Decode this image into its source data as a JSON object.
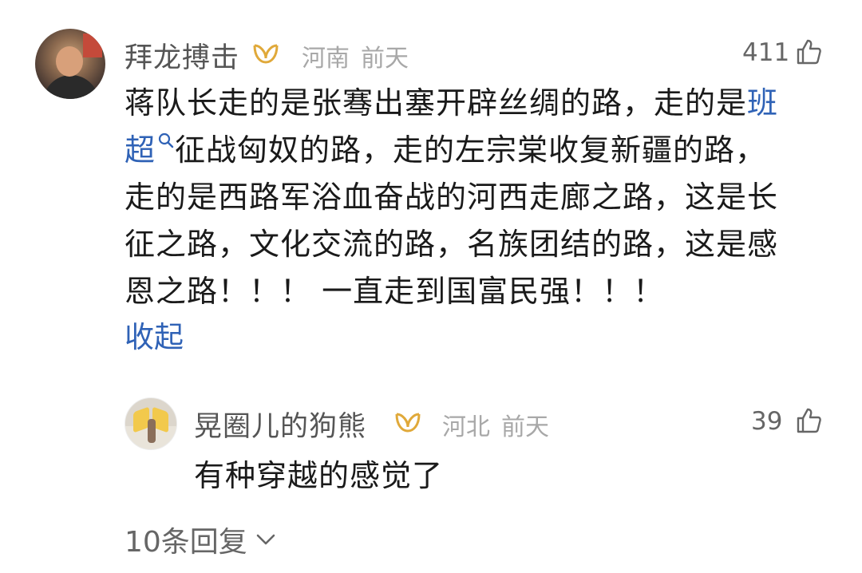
{
  "comment": {
    "author": "拜龙搏击",
    "region": "河南",
    "time": "前天",
    "likes": "411",
    "lines": [
      "蒋队长走的是张骞出塞开辟丝绸的路，走的是",
      "征战匈奴的路，走的左宗棠收复新疆的路，",
      "走的是西路军浴血奋战的河西走廊之路，这是长",
      "征之路，文化交流的路，名族团结的路，这是感",
      "恩之路！！！ 一直走到国富民强！！！"
    ],
    "link_part1": "班",
    "link_part2": "超",
    "collapse_label": "收起",
    "icons": {
      "avatar": "user-avatar-icon",
      "badge": "vip-badge-icon",
      "like": "thumbs-up-icon",
      "search": "search-icon"
    }
  },
  "reply": {
    "author": "晃圈儿的狗熊",
    "region": "河北",
    "time": "前天",
    "likes": "39",
    "text": "有种穿越的感觉了"
  },
  "more_replies_label": "10条回复",
  "colors": {
    "link": "#2f62b6",
    "badge_gold": "#e0a93a",
    "meta_gray": "#a8a8a8"
  }
}
